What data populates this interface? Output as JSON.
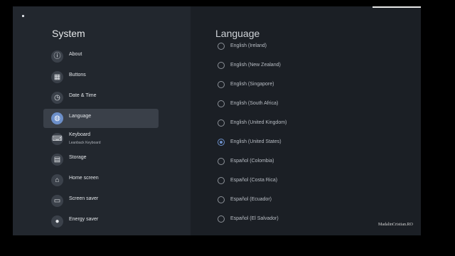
{
  "left": {
    "title": "System",
    "items": [
      {
        "label": "About",
        "icon": "info-icon",
        "glyph": "ⓘ",
        "sub": ""
      },
      {
        "label": "Buttons",
        "icon": "buttons-icon",
        "glyph": "▦",
        "sub": ""
      },
      {
        "label": "Date & Time",
        "icon": "clock-icon",
        "glyph": "◷",
        "sub": ""
      },
      {
        "label": "Language",
        "icon": "globe-icon",
        "glyph": "◍",
        "sub": ""
      },
      {
        "label": "Keyboard",
        "icon": "keyboard-icon",
        "glyph": "⌨",
        "sub": "Leanback Keyboard"
      },
      {
        "label": "Storage",
        "icon": "storage-icon",
        "glyph": "▤",
        "sub": ""
      },
      {
        "label": "Home screen",
        "icon": "home-icon",
        "glyph": "⌂",
        "sub": ""
      },
      {
        "label": "Screen saver",
        "icon": "screen-saver-icon",
        "glyph": "▭",
        "sub": ""
      },
      {
        "label": "Energy saver",
        "icon": "energy-icon",
        "glyph": "●",
        "sub": ""
      }
    ],
    "selected_index": 3
  },
  "right": {
    "title": "Language",
    "options": [
      {
        "label": "English (Ireland)",
        "checked": false
      },
      {
        "label": "English (New Zealand)",
        "checked": false
      },
      {
        "label": "English (Singapore)",
        "checked": false
      },
      {
        "label": "English (South Africa)",
        "checked": false
      },
      {
        "label": "English (United Kingdom)",
        "checked": false
      },
      {
        "label": "English (United States)",
        "checked": true
      },
      {
        "label": "Español (Colombia)",
        "checked": false
      },
      {
        "label": "Español (Costa Rica)",
        "checked": false
      },
      {
        "label": "Español (Ecuador)",
        "checked": false
      },
      {
        "label": "Español (El Salvador)",
        "checked": false
      }
    ]
  },
  "watermark": "MadalinCristian.RO",
  "colors": {
    "accent": "#6c8fc9",
    "bg": "#1e232a"
  }
}
